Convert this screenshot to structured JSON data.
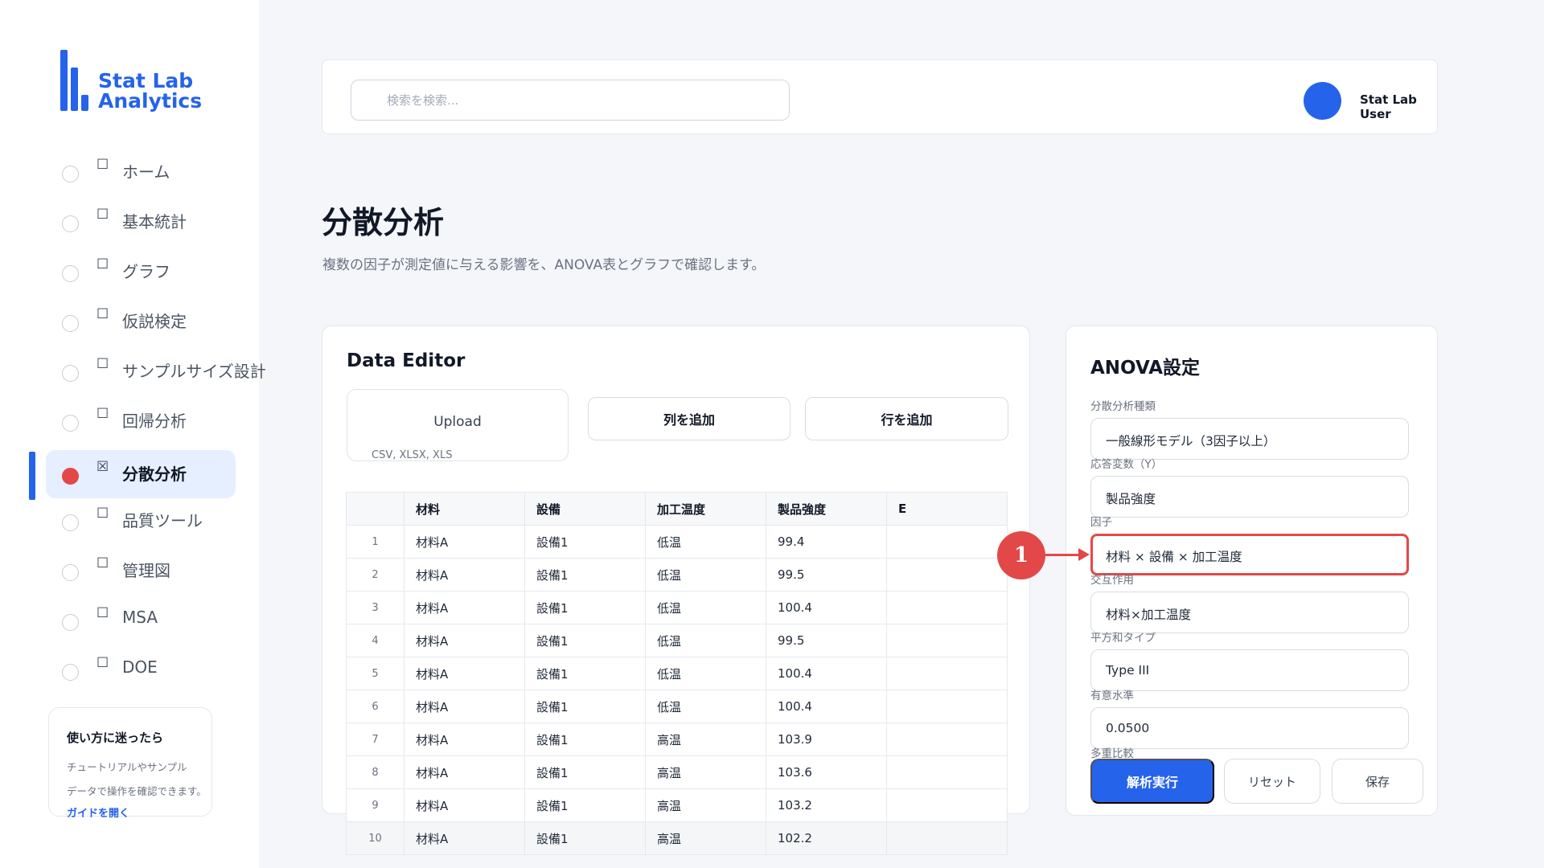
{
  "app": {
    "name": "Stat Lab Analytics"
  },
  "sidebar": {
    "box_glyph": "☐",
    "active_box_glyph": "☒",
    "items": [
      {
        "label": "ホーム"
      },
      {
        "label": "基本統計"
      },
      {
        "label": "グラフ"
      },
      {
        "label": "仮説検定"
      },
      {
        "label": "サンプルサイズ設計"
      },
      {
        "label": "回帰分析"
      },
      {
        "label": "分散分析",
        "active": true
      },
      {
        "label": "品質ツール"
      },
      {
        "label": "管理図"
      },
      {
        "label": "MSA"
      },
      {
        "label": "DOE"
      }
    ],
    "help": {
      "title": "使い方に迷ったら",
      "line1": "チュートリアルやサンプル",
      "line2": "データで操作を確認できます。",
      "link": "ガイドを開く"
    }
  },
  "header": {
    "search_placeholder": "検索を検索...",
    "user_name": "Stat Lab User"
  },
  "page": {
    "title": "分散分析",
    "subtitle": "複数の因子が測定値に与える影響を、ANOVA表とグラフで確認します。"
  },
  "editor": {
    "title": "Data Editor",
    "upload_label": "Upload",
    "upload_hint": "CSV, XLSX, XLS",
    "add_column": "列を追加",
    "add_row": "行を追加",
    "columns": [
      "",
      "材料",
      "設備",
      "加工温度",
      "製品強度",
      "E"
    ],
    "rows": [
      [
        "1",
        "材料A",
        "設備1",
        "低温",
        "99.4",
        ""
      ],
      [
        "2",
        "材料A",
        "設備1",
        "低温",
        "99.5",
        ""
      ],
      [
        "3",
        "材料A",
        "設備1",
        "低温",
        "100.4",
        ""
      ],
      [
        "4",
        "材料A",
        "設備1",
        "低温",
        "99.5",
        ""
      ],
      [
        "5",
        "材料A",
        "設備1",
        "低温",
        "100.4",
        ""
      ],
      [
        "6",
        "材料A",
        "設備1",
        "低温",
        "100.4",
        ""
      ],
      [
        "7",
        "材料A",
        "設備1",
        "高温",
        "103.9",
        ""
      ],
      [
        "8",
        "材料A",
        "設備1",
        "高温",
        "103.6",
        ""
      ],
      [
        "9",
        "材料A",
        "設備1",
        "高温",
        "103.2",
        ""
      ],
      [
        "10",
        "材料A",
        "設備1",
        "高温",
        "102.2",
        ""
      ]
    ]
  },
  "settings": {
    "title": "ANOVA設定",
    "anova_type_label": "分散分析種類",
    "anova_type_value": "一般線形モデル（3因子以上）",
    "response_label": "応答変数（Y）",
    "response_value": "製品強度",
    "factors_label": "因子",
    "factors_value": "材料 × 設備 × 加工温度",
    "interaction_label": "交互作用",
    "interaction_value": "材料×加工温度",
    "ss_type_label": "平方和タイプ",
    "ss_type_value": "Type III",
    "alpha_label": "有意水準",
    "alpha_value": "0.0500",
    "multiple_comparison_label": "多重比較",
    "run_button": "解析実行",
    "reset_button": "リセット",
    "save_button": "保存"
  },
  "annotation": {
    "marker_label": "1",
    "color": "#e34848"
  },
  "colors": {
    "accent": "#2563eb",
    "highlight": "#e34848"
  }
}
